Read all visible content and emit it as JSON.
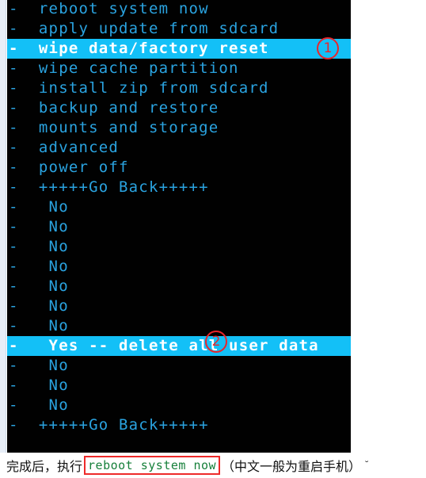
{
  "terminal": {
    "bullet": "-",
    "bg_color": "#010101",
    "text_color": "#2aa3e0",
    "highlight_bg": "#13c0f7",
    "highlight_text": "#ffffff",
    "lines": [
      {
        "text": "-  reboot system now",
        "selected": false
      },
      {
        "text": "-  apply update from sdcard",
        "selected": false
      },
      {
        "text": "-  wipe data/factory reset",
        "selected": true
      },
      {
        "text": "-  wipe cache partition",
        "selected": false
      },
      {
        "text": "-  install zip from sdcard",
        "selected": false
      },
      {
        "text": "-  backup and restore",
        "selected": false
      },
      {
        "text": "-  mounts and storage",
        "selected": false
      },
      {
        "text": "-  advanced",
        "selected": false
      },
      {
        "text": "-  power off",
        "selected": false
      },
      {
        "text": "-  +++++Go Back+++++",
        "selected": false
      },
      {
        "text": "-   No",
        "selected": false
      },
      {
        "text": "-   No",
        "selected": false
      },
      {
        "text": "-   No",
        "selected": false
      },
      {
        "text": "-   No",
        "selected": false
      },
      {
        "text": "-   No",
        "selected": false
      },
      {
        "text": "-   No",
        "selected": false
      },
      {
        "text": "-   No",
        "selected": false
      },
      {
        "text": "-   Yes -- delete all user data",
        "selected": true
      },
      {
        "text": "-   No",
        "selected": false
      },
      {
        "text": "-   No",
        "selected": false
      },
      {
        "text": "-   No",
        "selected": false
      },
      {
        "text": "-  +++++Go Back+++++",
        "selected": false
      }
    ]
  },
  "markers": {
    "one": "①",
    "two": "②",
    "one_label": "1",
    "two_label": "2",
    "color": "#e8262b"
  },
  "caption": {
    "prefix": "完成后，执行",
    "code": "reboot system now",
    "suffix": "（中文一般为重启手机）",
    "tail": "˘",
    "code_color": "#17803b",
    "box_color": "#ee2a2a"
  }
}
